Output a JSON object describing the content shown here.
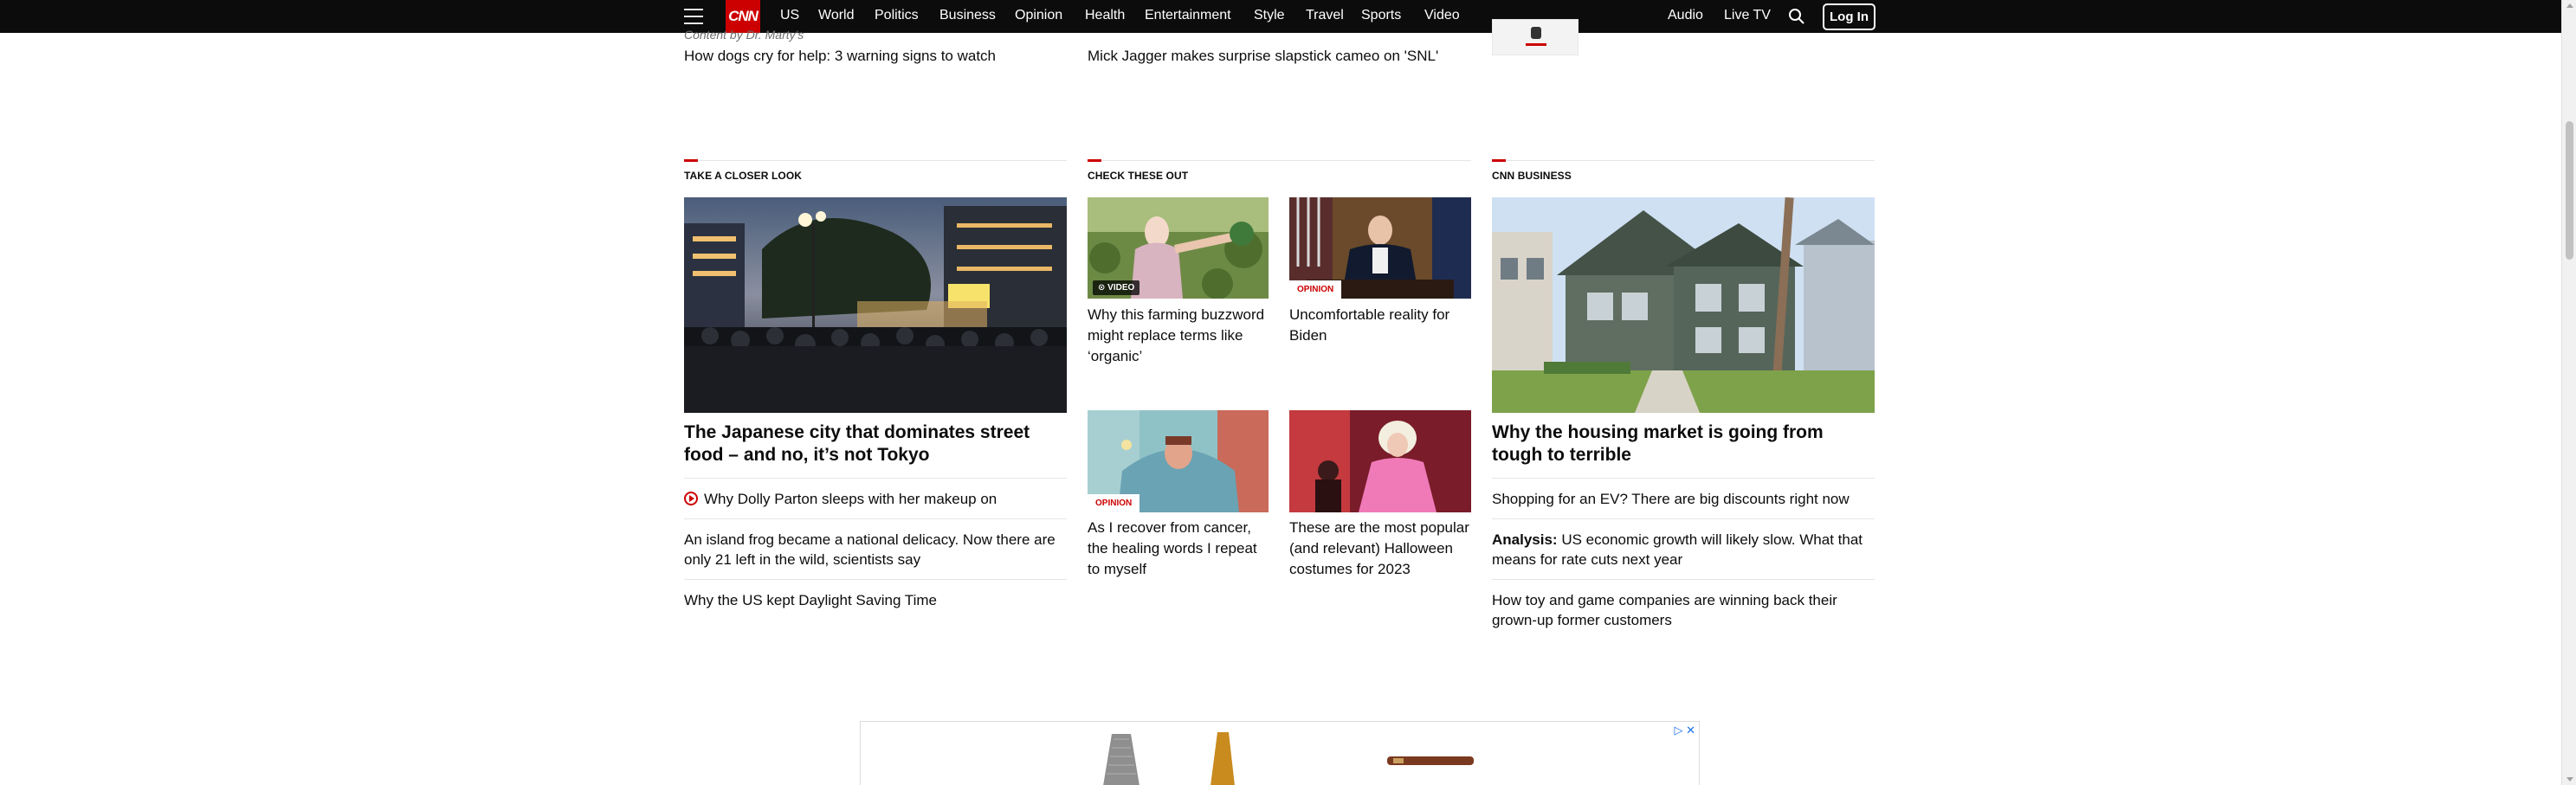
{
  "nav": {
    "logo": "CNN",
    "items": [
      "US",
      "World",
      "Politics",
      "Business",
      "Opinion",
      "Health",
      "Entertainment",
      "Style",
      "Travel",
      "Sports",
      "Video"
    ],
    "audio": "Audio",
    "live_tv": "Live TV",
    "login": "Log In"
  },
  "top_row": {
    "sponsor": "Content by Dr. Marty's",
    "left_link": "How dogs cry for help: 3 warning signs to watch",
    "mid_link": "Mick Jagger makes surprise slapstick cameo on 'SNL'"
  },
  "closer_look": {
    "title": "Take a closer look",
    "headline": "The Japanese city that dominates street food – and no, it’s not Tokyo",
    "links": [
      "Why Dolly Parton sleeps with her makeup on",
      "An island frog became a national delicacy. Now there are only 21 left in the wild, scientists say",
      "Why the US kept Daylight Saving Time"
    ]
  },
  "check_out": {
    "title": "Check these out",
    "cards": [
      {
        "badge": "VIDEO",
        "text": "Why this farming buzzword might replace terms like ‘organic’"
      },
      {
        "badge": "OPINION",
        "text": "Uncomfortable reality for Biden"
      },
      {
        "badge": "OPINION",
        "text": "As I recover from cancer, the healing words I repeat to myself"
      },
      {
        "badge": "",
        "text": "These are the most popular (and relevant) Halloween costumes for 2023"
      }
    ]
  },
  "business": {
    "title": "CNN Business",
    "headline": "Why the housing market is going from tough to terrible",
    "links": [
      "Shopping for an EV? There are big discounts right now",
      "How toy and game companies are winning back their grown-up former customers"
    ],
    "analysis_label": "Analysis:",
    "analysis_text": "US economic growth will likely slow. What that means for rate cuts next year"
  },
  "ad": {
    "choices": "▷ ✕"
  }
}
